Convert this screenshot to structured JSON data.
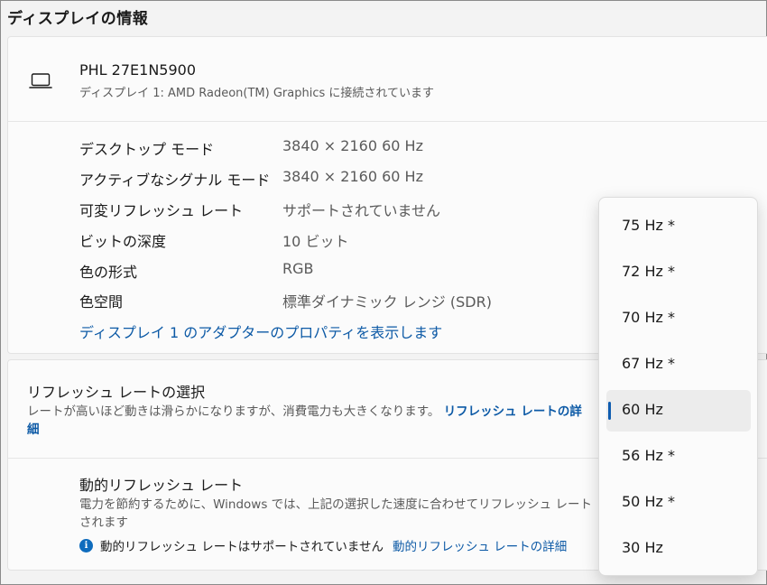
{
  "page_title": "ディスプレイの情報",
  "monitor": {
    "name": "PHL 27E1N5900",
    "subtitle": "ディスプレイ 1: AMD Radeon(TM) Graphics に接続されています",
    "icon": "laptop-icon"
  },
  "info_rows": [
    {
      "label": "デスクトップ モード",
      "value": "3840 × 2160 60 Hz"
    },
    {
      "label": "アクティブなシグナル モード",
      "value": "3840 × 2160 60 Hz"
    },
    {
      "label": "可変リフレッシュ レート",
      "value": "サポートされていません"
    },
    {
      "label": "ビットの深度",
      "value": "10 ビット"
    },
    {
      "label": "色の形式",
      "value": "RGB"
    },
    {
      "label": "色空間",
      "value": "標準ダイナミック レンジ (SDR)"
    }
  ],
  "adapter_link": "ディスプレイ 1 のアダプターのプロパティを表示します",
  "refresh": {
    "title": "リフレッシュ レートの選択",
    "description": "レートが高いほど動きは滑らかになりますが、消費電力も大きくなります。",
    "link": "リフレッシュ レートの詳細"
  },
  "dynamic": {
    "title": "動的リフレッシュ レート",
    "description": "電力を節約するために、Windows では、上記の選択した速度に合わせてリフレッシュ レート",
    "description_cont": "されます",
    "status": "動的リフレッシュ レートはサポートされていません",
    "link": "動的リフレッシュ レートの詳細"
  },
  "dropdown": {
    "options": [
      "75 Hz *",
      "72 Hz *",
      "70 Hz *",
      "67 Hz *",
      "60 Hz",
      "56 Hz *",
      "50 Hz *",
      "30 Hz"
    ],
    "selected": "60 Hz"
  },
  "colors": {
    "accent": "#0f6cbd",
    "link": "#0d5aa6"
  }
}
